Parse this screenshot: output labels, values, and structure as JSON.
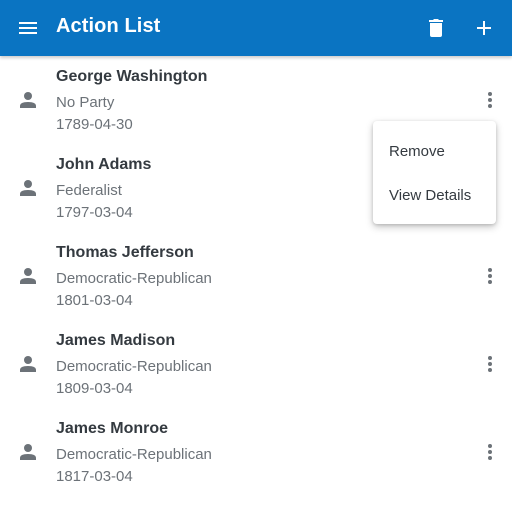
{
  "appbar": {
    "title": "Action List",
    "color": "#0a74c2",
    "menu_icon": "hamburger-menu-icon",
    "delete_icon": "trash-icon",
    "add_icon": "plus-icon"
  },
  "items": [
    {
      "name": "George Washington",
      "party": "No Party",
      "date": "1789-04-30",
      "has_menu": true
    },
    {
      "name": "John Adams",
      "party": "Federalist",
      "date": "1797-03-04",
      "has_menu": false
    },
    {
      "name": "Thomas Jefferson",
      "party": "Democratic-Republican",
      "date": "1801-03-04",
      "has_menu": true
    },
    {
      "name": "James Madison",
      "party": "Democratic-Republican",
      "date": "1809-03-04",
      "has_menu": true
    },
    {
      "name": "James Monroe",
      "party": "Democratic-Republican",
      "date": "1817-03-04",
      "has_menu": true
    }
  ],
  "popup_menu": {
    "options": [
      "Remove",
      "View Details"
    ]
  }
}
